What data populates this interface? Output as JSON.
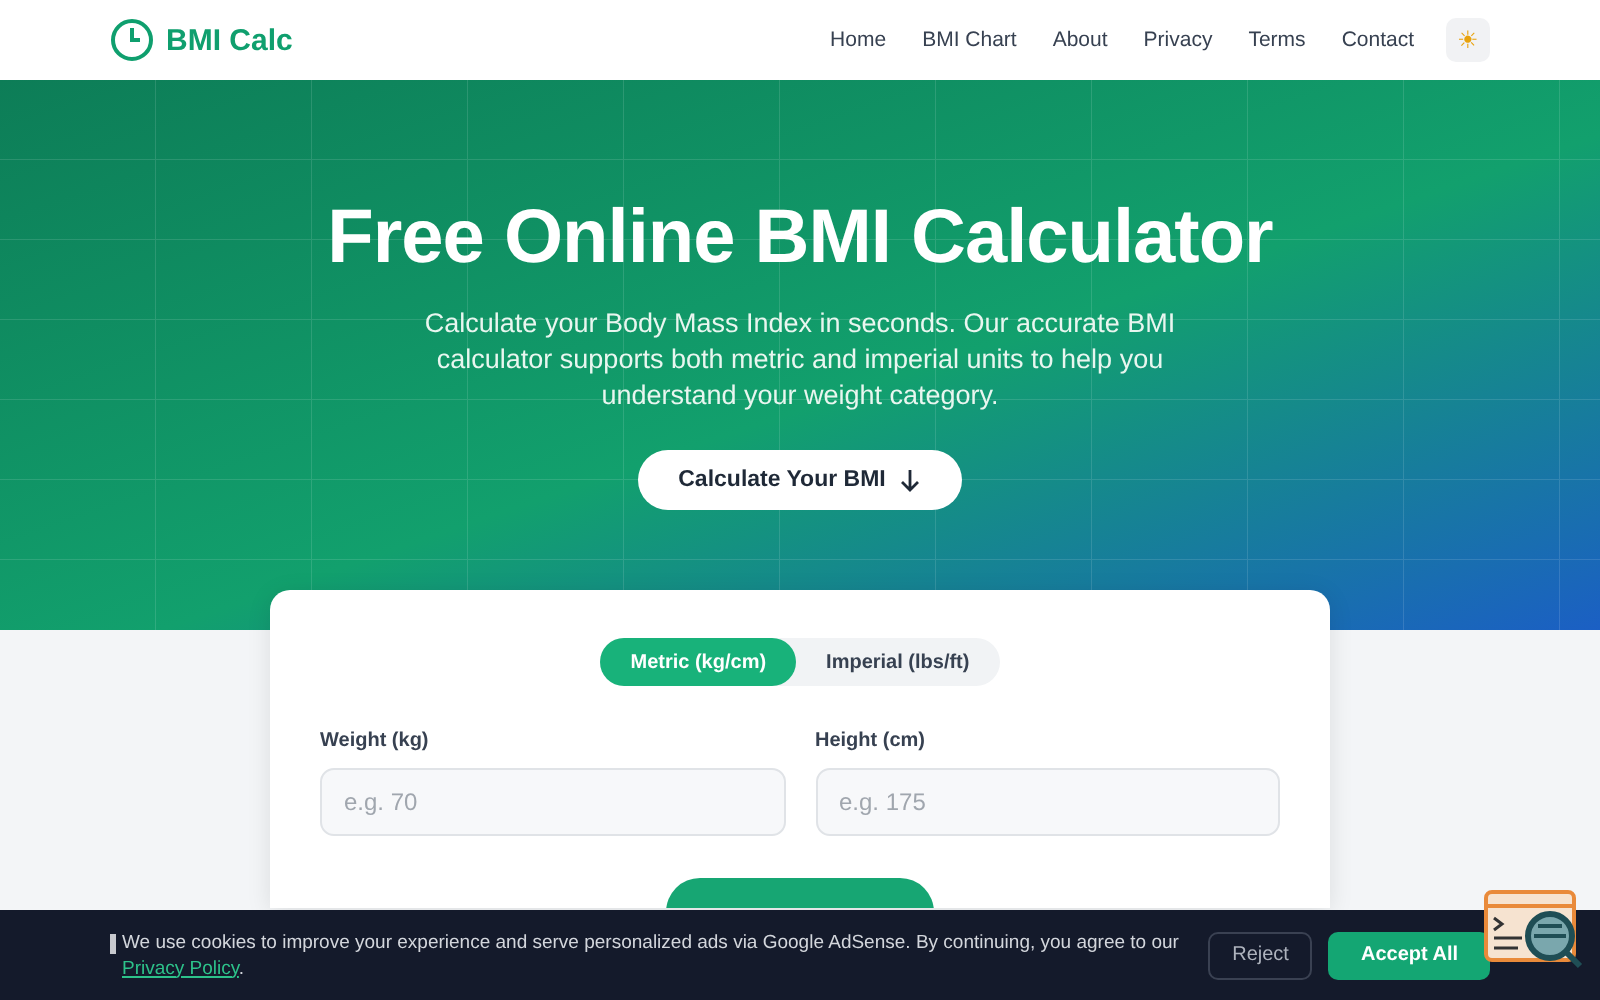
{
  "header": {
    "logo": "BMI Calc",
    "nav": [
      {
        "label": "Home"
      },
      {
        "label": "BMI Chart"
      },
      {
        "label": "About"
      },
      {
        "label": "Privacy"
      },
      {
        "label": "Terms"
      },
      {
        "label": "Contact"
      }
    ],
    "theme_toggle": "☀"
  },
  "hero": {
    "title": "Free Online BMI Calculator",
    "subtitle": "Calculate your Body Mass Index in seconds. Our accurate BMI calculator supports both metric and imperial units to help you understand your weight category.",
    "button": "Calculate Your BMI"
  },
  "calculator": {
    "units": [
      {
        "label": "Metric (kg/cm)",
        "selected": true
      },
      {
        "label": "Imperial (lbs/ft)",
        "selected": false
      }
    ],
    "fields": [
      {
        "label": "Weight (kg)",
        "placeholder": "e.g. 70"
      },
      {
        "label": "Height (cm)",
        "placeholder": "e.g. 175"
      }
    ]
  },
  "cookie_banner": {
    "text": "We use cookies to improve your experience and serve personalized ads via Google AdSense. By continuing, you agree to our",
    "link": "Privacy Policy",
    "end": ".",
    "buttons": [
      {
        "label": "Reject",
        "kind": "secondary"
      },
      {
        "label": "Accept All",
        "kind": "primary"
      }
    ]
  }
}
